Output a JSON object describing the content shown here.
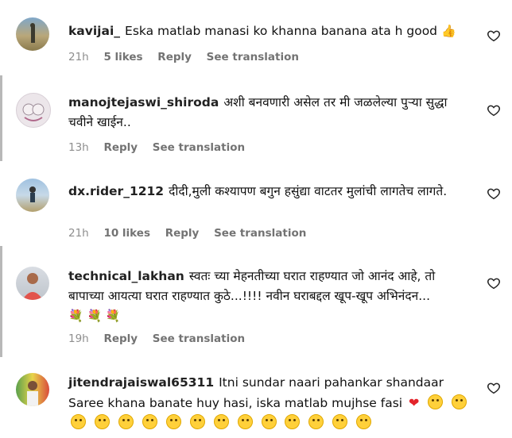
{
  "comments": [
    {
      "username": "kavijai_",
      "text": "Eska matlab manasi ko khanna banana ata h good",
      "emoji": "👍",
      "time": "21h",
      "likes": "5 likes",
      "reply": "Reply",
      "translation": "See translation"
    },
    {
      "username": "manojtejaswi_shiroda",
      "text": "अशी बनवणारी असेल तर मी जळलेल्या पुऱ्या सुद्धा चवीने खाईन..",
      "time": "13h",
      "reply": "Reply",
      "translation": "See translation"
    },
    {
      "username": "dx.rider_1212",
      "text": "दीदी,मुली कश्यापण बगुन हसुंद्या वाटतर मुलांची लागतेच लागते.",
      "time": "21h",
      "likes": "10 likes",
      "reply": "Reply",
      "translation": "See translation"
    },
    {
      "username": "technical_lakhan",
      "text": "स्वतः च्या मेहनतीच्या घरात राहण्यात जो आनंद आहे, तो बापाच्या आयत्या घरात राहण्यात कुठे...!!!! नवीन घराबद्दल खूप-खूप अभिनंदन...",
      "emojis": "💐 💐 💐",
      "time": "19h",
      "reply": "Reply",
      "translation": "See translation"
    },
    {
      "username": "jitendrajaiswal65311",
      "text": "Itni sundar naari pahankar shandaar Saree khana banate huy hasi, iska matlab mujhse fasi",
      "emoji_count": 15
    }
  ],
  "colors": {
    "meta": "#737373",
    "heart_outline": "#262626",
    "emoji_yellow": "#ffd03a"
  },
  "icons": {
    "like": "heart-outline-icon"
  }
}
